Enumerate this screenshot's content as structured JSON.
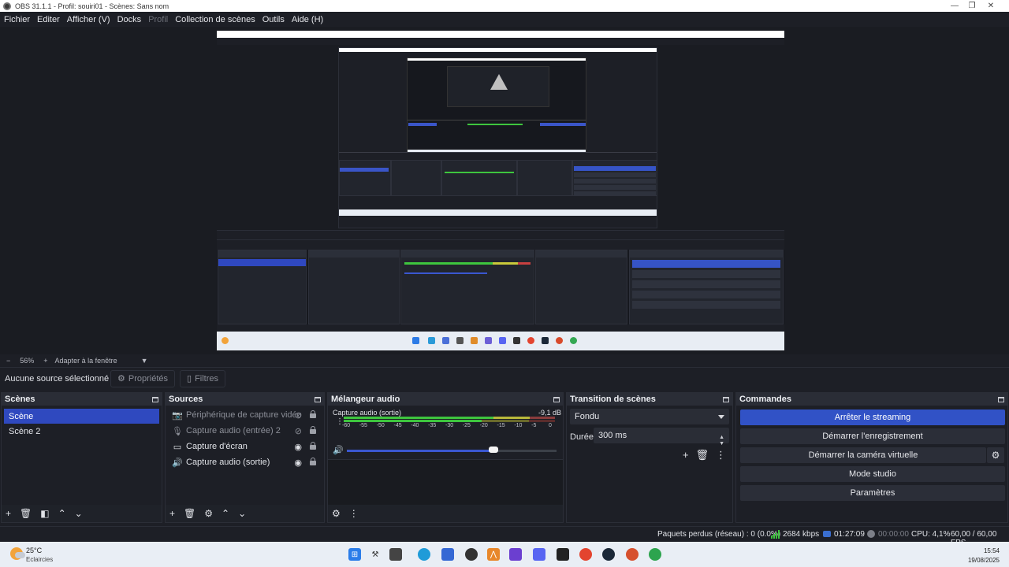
{
  "window": {
    "title": "OBS 31.1.1 - Profil: souiri01 - Scènes: Sans nom",
    "minimize": "—",
    "maximize": "❐",
    "close": "✕"
  },
  "menu": [
    "Fichier",
    "Editer",
    "Afficher (V)",
    "Docks",
    "Profil",
    "Collection de scènes",
    "Outils",
    "Aide (H)"
  ],
  "zoom": {
    "minus": "−",
    "value": "56%",
    "plus": "+",
    "fit": "Adapter à la fenêtre",
    "arrow": "▼"
  },
  "toolbar": {
    "no_source": "Aucune source sélectionné",
    "properties": "Propriétés",
    "filters": "Filtres"
  },
  "docks": {
    "scenes": {
      "title": "Scènes",
      "items": [
        "Scène",
        "Scène 2"
      ],
      "active_index": 0
    },
    "sources": {
      "title": "Sources",
      "items": [
        {
          "label": "Périphérique de capture vidéo",
          "icon": "camera-icon",
          "visible": false
        },
        {
          "label": "Capture audio (entrée) 2",
          "icon": "microphone-icon",
          "visible": false
        },
        {
          "label": "Capture d'écran",
          "icon": "monitor-icon",
          "visible": true
        },
        {
          "label": "Capture audio (sortie)",
          "icon": "speaker-icon",
          "visible": true
        }
      ]
    },
    "mixer": {
      "title": "Mélangeur audio",
      "track": {
        "name": "Capture audio (sortie)",
        "db": "-9,1 dB",
        "volume_fraction": 0.7
      },
      "ticks": [
        "-60",
        "-55",
        "-50",
        "-45",
        "-40",
        "-35",
        "-30",
        "-25",
        "-20",
        "-15",
        "-10",
        "-5",
        "0"
      ]
    },
    "transitions": {
      "title": "Transition de scènes",
      "type": "Fondu",
      "duration_label": "Durée",
      "duration": "300 ms"
    },
    "controls": {
      "title": "Commandes",
      "stop_streaming": "Arrêter le streaming",
      "start_recording": "Démarrer l'enregistrement",
      "virtual_cam": "Démarrer la caméra virtuelle",
      "studio_mode": "Mode studio",
      "settings": "Paramètres"
    }
  },
  "status": {
    "dropped": "Paquets perdus (réseau) : 0 (0.0%)",
    "bitrate": "2684 kbps",
    "stream_time": "01:27:09",
    "rec_time": "00:00:00",
    "cpu": "CPU: 4,1%",
    "fps": "60,00 / 60,00 FPS"
  },
  "taskbar": {
    "temperature": "25°C",
    "condition": "Eclaircies",
    "time": "15:54",
    "date": "19/08/2025"
  },
  "colors": {
    "accent": "#2f49bf",
    "meter_green": "#3ec53e",
    "meter_yellow": "#c9c93a",
    "meter_red": "#c84040"
  }
}
